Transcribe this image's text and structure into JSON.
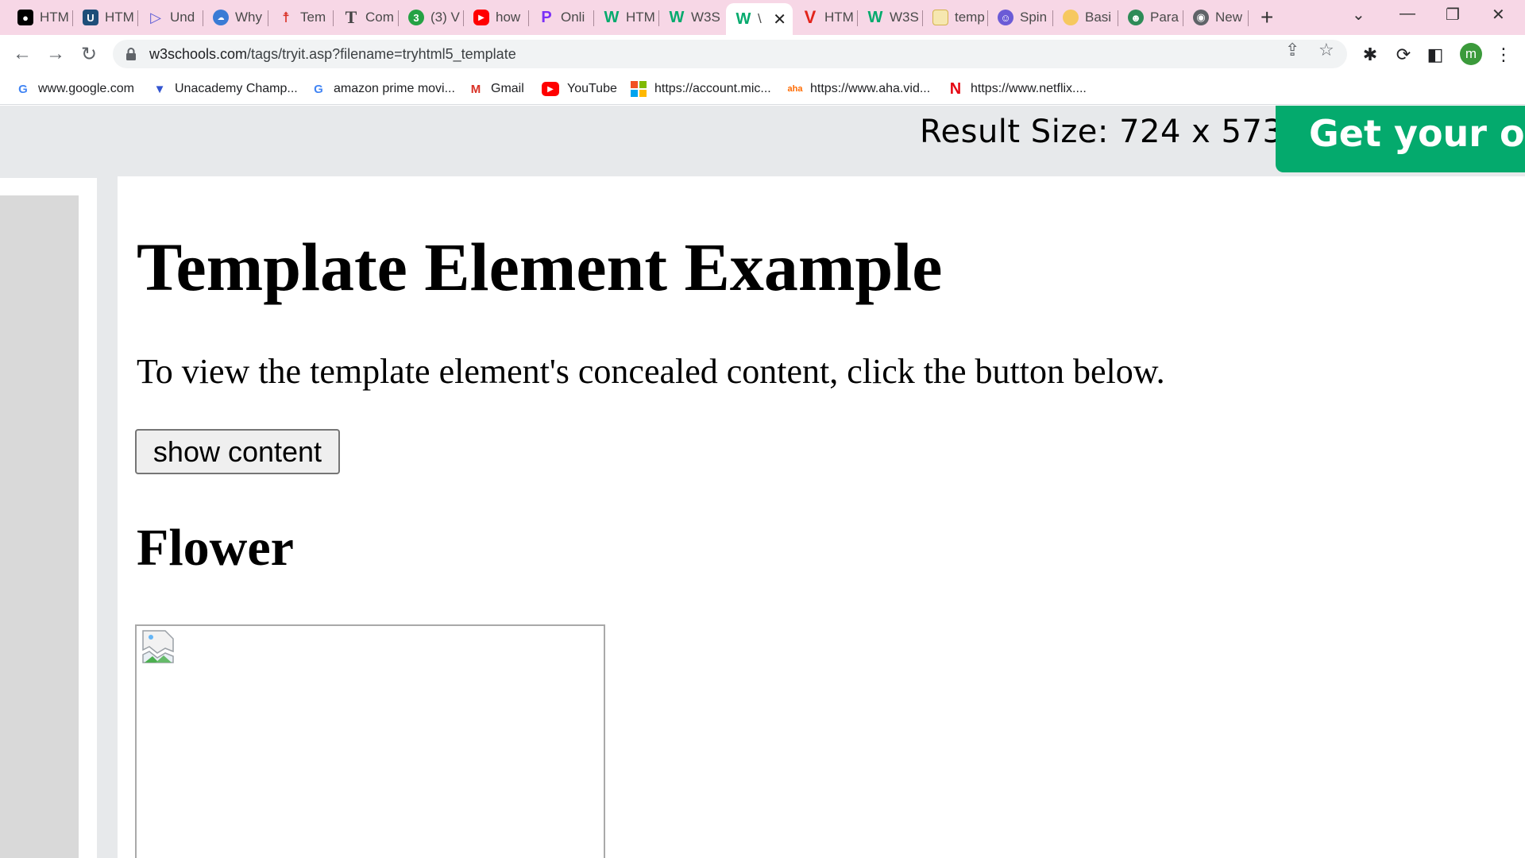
{
  "tabs": [
    {
      "label": "HTM",
      "icon": "medium-icon",
      "color": "#000000"
    },
    {
      "label": "HTM",
      "icon": "ub-icon",
      "color": "#1f4e79"
    },
    {
      "label": "Und",
      "icon": "play-outline-icon",
      "color": "#5b5bd6"
    },
    {
      "label": "Why",
      "icon": "cloud-icon",
      "color": "#3a7bd5"
    },
    {
      "label": "Tem",
      "icon": "person-icon",
      "color": "#d93025"
    },
    {
      "label": "Com",
      "icon": "t-letter-icon",
      "color": "#444444"
    },
    {
      "label": "(3) V",
      "icon": "whatsapp-badge-icon",
      "color": "#25a244"
    },
    {
      "label": "how",
      "icon": "youtube-icon",
      "color": "#ff0000"
    },
    {
      "label": "Onli",
      "icon": "p-letter-icon",
      "color": "#7b2ff7"
    },
    {
      "label": "HTM",
      "icon": "w3-icon",
      "color": "#04aa6d"
    },
    {
      "label": "W3S",
      "icon": "w3-icon",
      "color": "#04aa6d"
    },
    {
      "label": "\\",
      "icon": "w3-icon",
      "color": "#04aa6d"
    },
    {
      "label": "HTM",
      "icon": "v-letter-icon",
      "color": "#e2231a"
    },
    {
      "label": "W3S",
      "icon": "w3-icon",
      "color": "#04aa6d"
    },
    {
      "label": "temp",
      "icon": "image-icon",
      "color": "#f2c94c"
    },
    {
      "label": "Spin",
      "icon": "mascot-icon",
      "color": "#6b5bd6"
    },
    {
      "label": "Basi",
      "icon": "circle-icon",
      "color": "#f6c85f"
    },
    {
      "label": "Para",
      "icon": "robot-icon",
      "color": "#2e8b57"
    },
    {
      "label": "New",
      "icon": "chrome-icon",
      "color": "#5f6368"
    }
  ],
  "address": {
    "host": "w3schools.com",
    "path": "/tags/tryit.asp?filename=tryhtml5_template"
  },
  "profile_initial": "m",
  "bookmarks": [
    {
      "label": "www.google.com",
      "icon": "google-icon",
      "color": "#4285f4"
    },
    {
      "label": "Unacademy Champ...",
      "icon": "unacademy-icon",
      "color": "#3355d0"
    },
    {
      "label": "amazon prime movi...",
      "icon": "google-icon",
      "color": "#4285f4"
    },
    {
      "label": "Gmail",
      "icon": "gmail-icon",
      "color": "#d93025"
    },
    {
      "label": "YouTube",
      "icon": "youtube-icon",
      "color": "#ff0000"
    },
    {
      "label": "https://account.mic...",
      "icon": "microsoft-icon",
      "color": "#f25022"
    },
    {
      "label": "https://www.aha.vid...",
      "icon": "aha-icon",
      "color": "#ff6a00"
    },
    {
      "label": "https://www.netflix....",
      "icon": "netflix-icon",
      "color": "#e50914"
    }
  ],
  "tryit": {
    "result_size": "Result Size: 724 x 573",
    "get_own": "Get your own"
  },
  "result": {
    "heading": "Template Element Example",
    "description": "To view the template element's concealed content, click the button below.",
    "button": "show content",
    "subheading": "Flower"
  },
  "colors": {
    "accent": "#04aa6d",
    "tabstrip": "#f7d7e6",
    "panel": "#e7e9eb"
  }
}
